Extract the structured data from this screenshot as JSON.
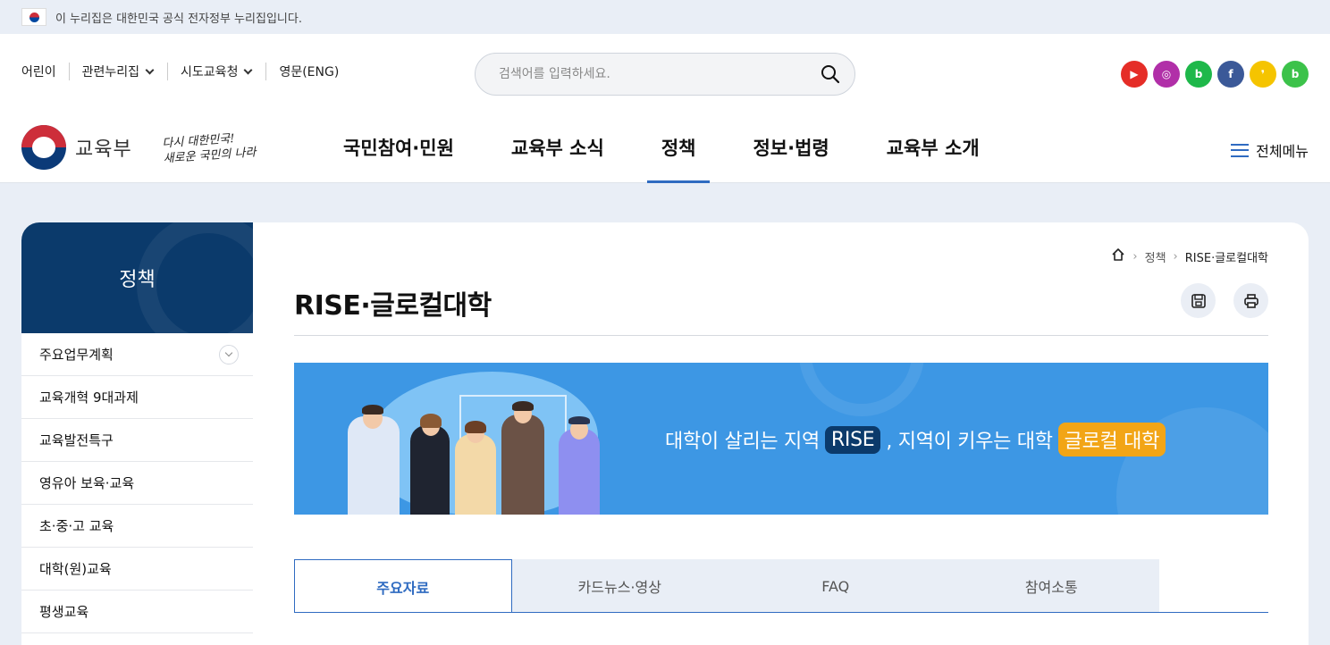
{
  "gov_banner": {
    "text": "이 누리집은 대한민국 공식 전자정부 누리집입니다."
  },
  "util_links": [
    {
      "label": "어린이",
      "dropdown": false
    },
    {
      "label": "관련누리집",
      "dropdown": true
    },
    {
      "label": "시도교육청",
      "dropdown": true
    },
    {
      "label": "영문(ENG)",
      "dropdown": false
    }
  ],
  "search": {
    "placeholder": "검색어를 입력하세요."
  },
  "sns": [
    {
      "name": "youtube-icon",
      "color": "#e52d27",
      "glyph": "▶"
    },
    {
      "name": "instagram-icon",
      "color": "#b12fa8",
      "glyph": "◎"
    },
    {
      "name": "blog-icon",
      "color": "#1eb84a",
      "glyph": "b"
    },
    {
      "name": "facebook-icon",
      "color": "#3b5998",
      "glyph": "f"
    },
    {
      "name": "kakaostory-icon",
      "color": "#f5c400",
      "glyph": "❜"
    },
    {
      "name": "band-icon",
      "color": "#3cc24a",
      "glyph": "b"
    }
  ],
  "logo": {
    "text": "교육부"
  },
  "slogan": {
    "line1": "다시 대한민국!",
    "line2": "새로운 국민의 나라"
  },
  "gnb": {
    "items": [
      "국민참여·민원",
      "교육부 소식",
      "정책",
      "정보·법령",
      "교육부 소개"
    ],
    "active_index": 2
  },
  "allmenu": {
    "label": "전체메뉴"
  },
  "sidebar": {
    "title": "정책",
    "items": [
      {
        "label": "주요업무계획",
        "expandable": true
      },
      {
        "label": "교육개혁 9대과제",
        "expandable": false
      },
      {
        "label": "교육발전특구",
        "expandable": false
      },
      {
        "label": "영유아 보육·교육",
        "expandable": false
      },
      {
        "label": "초·중·고 교육",
        "expandable": false
      },
      {
        "label": "대학(원)교육",
        "expandable": false
      },
      {
        "label": "평생교육",
        "expandable": false
      }
    ]
  },
  "breadcrumb": [
    "정책",
    "RISE·글로컬대학"
  ],
  "page": {
    "title": "RISE·글로컬대학"
  },
  "banner": {
    "text_before": "대학이 살리는 지역",
    "tag1": "RISE",
    "text_middle": ", 지역이 키우는 대학",
    "tag2": "글로컬 대학",
    "bg_color": "#3d97e4"
  },
  "tabs": {
    "items": [
      "주요자료",
      "카드뉴스·영상",
      "FAQ",
      "참여소통"
    ],
    "active_index": 0
  },
  "colors": {
    "accent": "#2f6bc1",
    "navy": "#0b3a6b"
  }
}
